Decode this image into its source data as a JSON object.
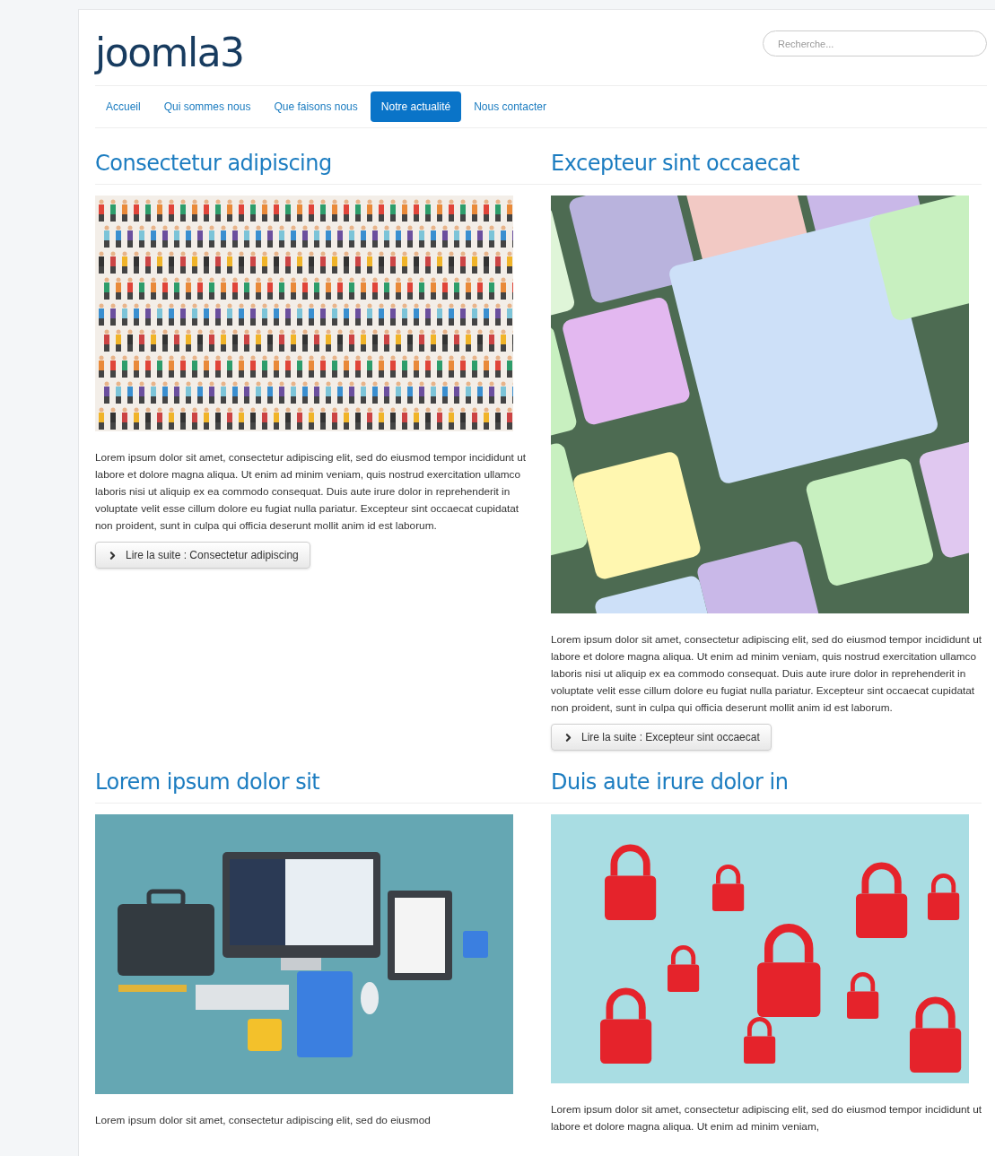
{
  "site_title": "joomla3",
  "search": {
    "placeholder": "Recherche..."
  },
  "nav": [
    {
      "label": "Accueil",
      "selected": false
    },
    {
      "label": "Qui sommes nous",
      "selected": false
    },
    {
      "label": "Que faisons nous",
      "selected": false
    },
    {
      "label": "Notre actualité",
      "selected": true
    },
    {
      "label": "Nous contacter",
      "selected": false
    }
  ],
  "articles": [
    {
      "title": "Consectetur adipiscing",
      "kind": "crowd",
      "text": "Lorem ipsum dolor sit amet, consectetur adipiscing elit, sed do eiusmod tempor incididunt ut labore et dolore magna aliqua. Ut enim ad minim veniam, quis nostrud exercitation ullamco laboris nisi ut aliquip ex ea commodo consequat. Duis aute irure dolor in reprehenderit in voluptate velit esse cillum dolore eu fugiat nulla pariatur. Excepteur sint occaecat cupidatat non proident, sunt in culpa qui officia deserunt mollit anim id est laborum.",
      "read_more": "Lire la suite : Consectetur adipiscing"
    },
    {
      "title": "Excepteur sint occaecat",
      "kind": "keyboard",
      "text": "Lorem ipsum dolor sit amet, consectetur adipiscing elit, sed do eiusmod tempor incididunt ut labore et dolore magna aliqua. Ut enim ad minim veniam, quis nostrud exercitation ullamco laboris nisi ut aliquip ex ea commodo consequat. Duis aute irure dolor in reprehenderit in voluptate velit esse cillum dolore eu fugiat nulla pariatur. Excepteur sint occaecat cupidatat non proident, sunt in culpa qui officia deserunt mollit anim id est laborum.",
      "read_more": "Lire la suite : Excepteur sint occaecat"
    },
    {
      "title": "Lorem ipsum dolor sit",
      "kind": "office",
      "text": "Lorem ipsum dolor sit amet, consectetur adipiscing elit, sed do eiusmod"
    },
    {
      "title": "Duis aute irure dolor in",
      "kind": "padlocks",
      "text": "Lorem ipsum dolor sit amet, consectetur adipiscing elit, sed do eiusmod tempor incididunt ut labore et dolore magna aliqua. Ut enim ad minim veniam,"
    }
  ]
}
